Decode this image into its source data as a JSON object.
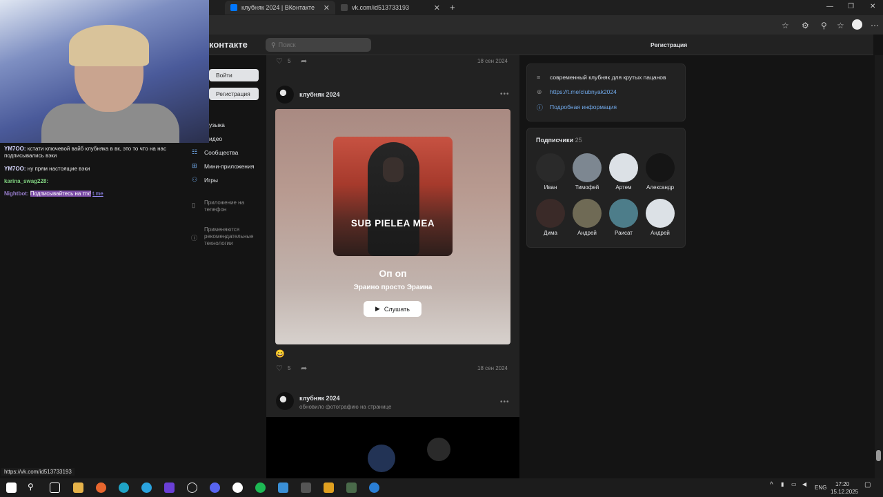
{
  "browser": {
    "tabs": [
      {
        "label": "клубняк 2024 | ВКонтакте"
      },
      {
        "label": "vk.com/id513733193"
      }
    ]
  },
  "vk": {
    "logo": "контакте",
    "search_placeholder": "Поиск",
    "header_register": "Регистрация",
    "login_button": "Войти",
    "register_button": "Регистрация",
    "menu": [
      "узыка",
      "идео",
      "Сообщества",
      "Мини-приложения",
      "Игры"
    ],
    "app_label": "Приложение на телефон",
    "tech_label": "Применяются рекомендательные технологии"
  },
  "feed": {
    "post0": {
      "likes": "5",
      "date": "18 сен 2024"
    },
    "post1": {
      "author": "клубняк 2024",
      "cover_text": "SUB PIELEA MEA",
      "song_title": "Оп оп",
      "song_artist": "Эраино просто Эраина",
      "listen_label": "Слушать",
      "emoji": "😄",
      "likes": "5",
      "date": "18 сен 2024"
    },
    "post2": {
      "author": "клубняк 2024",
      "subtitle": "обновило фотографию на странице"
    }
  },
  "info": {
    "description": "современный клубняк для крутых пацанов",
    "link": "https://t.me/clubnyak2024",
    "more": "Подробная информация"
  },
  "subscribers": {
    "title": "Подписчики",
    "count": "25",
    "people": [
      "Иван",
      "Тимофей",
      "Артем",
      "Александр",
      "Дима",
      "Андрей",
      "Раисат",
      "Андрей"
    ]
  },
  "chat": [
    {
      "user": "YM7OO:",
      "text": "кстати ключевой вайб клубняка в вк, это то что на нас подписывались вэки"
    },
    {
      "user": "YM7OO:",
      "text": "ну прям настоящие вэки"
    },
    {
      "user": "karina_swag228:",
      "text": ""
    },
    {
      "user": "Nightbot:",
      "text": "Подписывайтесь на тгк!",
      "link": "t.me"
    }
  ],
  "status_url": "https://vk.com/id513733193",
  "tray": {
    "lang": "ENG",
    "time": "17:20",
    "date": "15.12.2025"
  },
  "colors": {
    "vk_link": "#71aaeb",
    "bg": "#141414",
    "card": "#222222"
  }
}
